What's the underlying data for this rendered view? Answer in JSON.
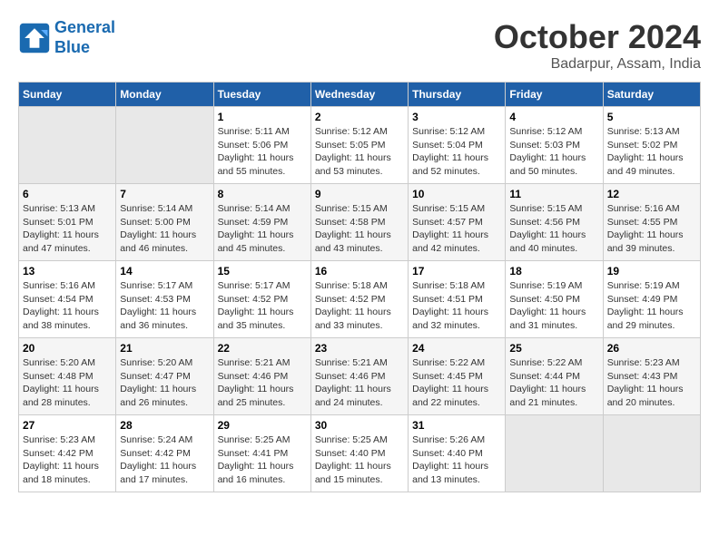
{
  "logo": {
    "line1": "General",
    "line2": "Blue"
  },
  "title": "October 2024",
  "location": "Badarpur, Assam, India",
  "weekdays": [
    "Sunday",
    "Monday",
    "Tuesday",
    "Wednesday",
    "Thursday",
    "Friday",
    "Saturday"
  ],
  "weeks": [
    [
      {
        "day": "",
        "empty": true
      },
      {
        "day": "",
        "empty": true
      },
      {
        "day": "1",
        "sunrise": "5:11 AM",
        "sunset": "5:06 PM",
        "daylight": "11 hours and 55 minutes."
      },
      {
        "day": "2",
        "sunrise": "5:12 AM",
        "sunset": "5:05 PM",
        "daylight": "11 hours and 53 minutes."
      },
      {
        "day": "3",
        "sunrise": "5:12 AM",
        "sunset": "5:04 PM",
        "daylight": "11 hours and 52 minutes."
      },
      {
        "day": "4",
        "sunrise": "5:12 AM",
        "sunset": "5:03 PM",
        "daylight": "11 hours and 50 minutes."
      },
      {
        "day": "5",
        "sunrise": "5:13 AM",
        "sunset": "5:02 PM",
        "daylight": "11 hours and 49 minutes."
      }
    ],
    [
      {
        "day": "6",
        "sunrise": "5:13 AM",
        "sunset": "5:01 PM",
        "daylight": "11 hours and 47 minutes."
      },
      {
        "day": "7",
        "sunrise": "5:14 AM",
        "sunset": "5:00 PM",
        "daylight": "11 hours and 46 minutes."
      },
      {
        "day": "8",
        "sunrise": "5:14 AM",
        "sunset": "4:59 PM",
        "daylight": "11 hours and 45 minutes."
      },
      {
        "day": "9",
        "sunrise": "5:15 AM",
        "sunset": "4:58 PM",
        "daylight": "11 hours and 43 minutes."
      },
      {
        "day": "10",
        "sunrise": "5:15 AM",
        "sunset": "4:57 PM",
        "daylight": "11 hours and 42 minutes."
      },
      {
        "day": "11",
        "sunrise": "5:15 AM",
        "sunset": "4:56 PM",
        "daylight": "11 hours and 40 minutes."
      },
      {
        "day": "12",
        "sunrise": "5:16 AM",
        "sunset": "4:55 PM",
        "daylight": "11 hours and 39 minutes."
      }
    ],
    [
      {
        "day": "13",
        "sunrise": "5:16 AM",
        "sunset": "4:54 PM",
        "daylight": "11 hours and 38 minutes."
      },
      {
        "day": "14",
        "sunrise": "5:17 AM",
        "sunset": "4:53 PM",
        "daylight": "11 hours and 36 minutes."
      },
      {
        "day": "15",
        "sunrise": "5:17 AM",
        "sunset": "4:52 PM",
        "daylight": "11 hours and 35 minutes."
      },
      {
        "day": "16",
        "sunrise": "5:18 AM",
        "sunset": "4:52 PM",
        "daylight": "11 hours and 33 minutes."
      },
      {
        "day": "17",
        "sunrise": "5:18 AM",
        "sunset": "4:51 PM",
        "daylight": "11 hours and 32 minutes."
      },
      {
        "day": "18",
        "sunrise": "5:19 AM",
        "sunset": "4:50 PM",
        "daylight": "11 hours and 31 minutes."
      },
      {
        "day": "19",
        "sunrise": "5:19 AM",
        "sunset": "4:49 PM",
        "daylight": "11 hours and 29 minutes."
      }
    ],
    [
      {
        "day": "20",
        "sunrise": "5:20 AM",
        "sunset": "4:48 PM",
        "daylight": "11 hours and 28 minutes."
      },
      {
        "day": "21",
        "sunrise": "5:20 AM",
        "sunset": "4:47 PM",
        "daylight": "11 hours and 26 minutes."
      },
      {
        "day": "22",
        "sunrise": "5:21 AM",
        "sunset": "4:46 PM",
        "daylight": "11 hours and 25 minutes."
      },
      {
        "day": "23",
        "sunrise": "5:21 AM",
        "sunset": "4:46 PM",
        "daylight": "11 hours and 24 minutes."
      },
      {
        "day": "24",
        "sunrise": "5:22 AM",
        "sunset": "4:45 PM",
        "daylight": "11 hours and 22 minutes."
      },
      {
        "day": "25",
        "sunrise": "5:22 AM",
        "sunset": "4:44 PM",
        "daylight": "11 hours and 21 minutes."
      },
      {
        "day": "26",
        "sunrise": "5:23 AM",
        "sunset": "4:43 PM",
        "daylight": "11 hours and 20 minutes."
      }
    ],
    [
      {
        "day": "27",
        "sunrise": "5:23 AM",
        "sunset": "4:42 PM",
        "daylight": "11 hours and 18 minutes."
      },
      {
        "day": "28",
        "sunrise": "5:24 AM",
        "sunset": "4:42 PM",
        "daylight": "11 hours and 17 minutes."
      },
      {
        "day": "29",
        "sunrise": "5:25 AM",
        "sunset": "4:41 PM",
        "daylight": "11 hours and 16 minutes."
      },
      {
        "day": "30",
        "sunrise": "5:25 AM",
        "sunset": "4:40 PM",
        "daylight": "11 hours and 15 minutes."
      },
      {
        "day": "31",
        "sunrise": "5:26 AM",
        "sunset": "4:40 PM",
        "daylight": "11 hours and 13 minutes."
      },
      {
        "day": "",
        "empty": true
      },
      {
        "day": "",
        "empty": true
      }
    ]
  ],
  "labels": {
    "sunrise": "Sunrise:",
    "sunset": "Sunset:",
    "daylight": "Daylight:"
  }
}
